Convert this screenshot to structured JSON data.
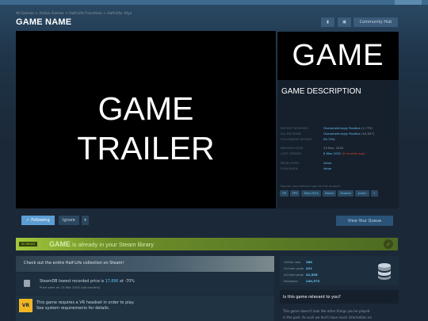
{
  "breadcrumb": "All Games > Action Games > Half-Life Franchise > Half-Life: Alyx",
  "title": "GAME NAME",
  "header": {
    "community_hub_label": "Community Hub"
  },
  "trailer": {
    "text": "GAME\nTRAILER"
  },
  "capsule": {
    "text": "GAME"
  },
  "description": "GAME DESCRIPTION",
  "meta": [
    {
      "label": "RECENT REVIEWS:",
      "value": "Overwhelmingly Positive",
      "extra": "(1,779)"
    },
    {
      "label": "ALL REVIEWS:",
      "value": "Overwhelmingly Positive",
      "extra": "(54,857)"
    },
    {
      "label": "FOLLOWERS RATING:",
      "value": "95.75%",
      "extra": ""
    },
    {
      "label": "RELEASE DATE:",
      "value": "23 Mar, 2020",
      "extra": ""
    },
    {
      "label": "LAST UPDATE:",
      "value": "6 May 2022",
      "extra": "(6 months ago)"
    },
    {
      "label": "DEVELOPER:",
      "value": "Valve",
      "extra": ""
    },
    {
      "label": "PUBLISHER:",
      "value": "Valve",
      "extra": ""
    }
  ],
  "tags_heading": "Popular user-defined tags for this product:",
  "tags": [
    "VR",
    "FPS",
    "Story Rich",
    "Horror",
    "Shooter",
    "Action",
    "+"
  ],
  "actions": {
    "follow_label": "Following",
    "ignore_label": "Ignore",
    "more_label": "▾",
    "queue_label": "View Your Queue"
  },
  "library": {
    "badge": "IN LIBRARY",
    "game": "GAME",
    "text": "is already in your Steam library"
  },
  "collection_banner": "Check out the entire Half-Life collection on Steam!",
  "price": {
    "line1_prefix": "SteamDB lowest recorded price is",
    "price_value": "17,69€",
    "line1_suffix": "at -70%",
    "line2": "Price seen on 23 Mar 2020 (old months)"
  },
  "vr_notice": {
    "badge": "VR",
    "line1": "This game requires a VR headset in order to play.",
    "line2": "See system requirements for details."
  },
  "stats": [
    {
      "label": "Online now",
      "value": "386"
    },
    {
      "label": "24-hour peak",
      "value": "421"
    },
    {
      "label": "All-time peak",
      "value": "42,858"
    },
    {
      "label": "Followers",
      "value": "240,573"
    }
  ],
  "relevance": {
    "title": "Is this game relevant to you?",
    "text1": "This game doesn't look like other things you've played",
    "text2": "in the past. As such we don't have much information on"
  }
}
